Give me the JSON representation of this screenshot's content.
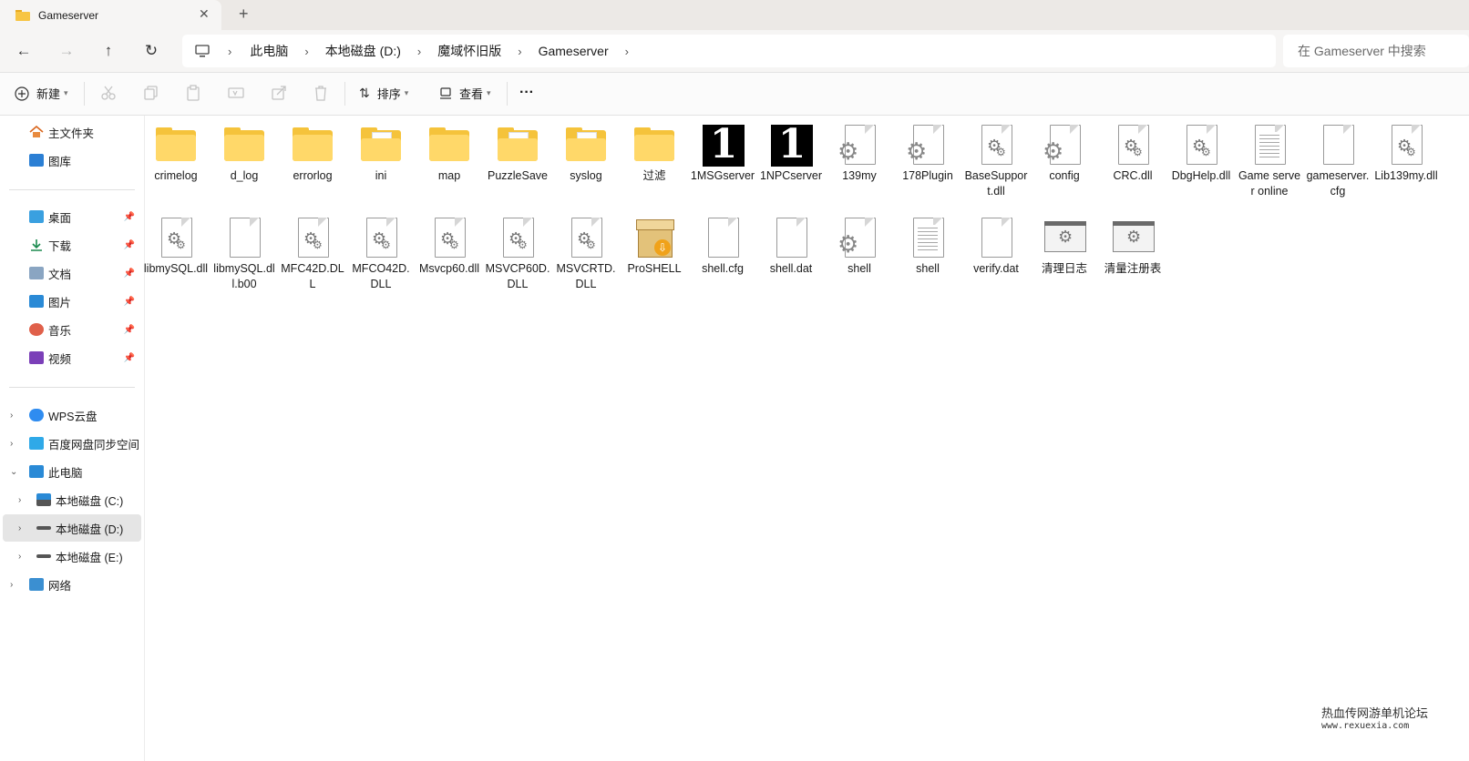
{
  "tab": {
    "title": "Gameserver",
    "close": "✕",
    "new": "+"
  },
  "nav": {
    "back": "←",
    "forward": "→",
    "up": "↑",
    "refresh": "↻"
  },
  "breadcrumb": [
    "此电脑",
    "本地磁盘 (D:)",
    "魔域怀旧版",
    "Gameserver"
  ],
  "breadcrumb_sep": "›",
  "search": {
    "placeholder": "在 Gameserver 中搜索"
  },
  "toolbar": {
    "new_label": "新建",
    "sort_label": "排序",
    "view_label": "查看",
    "more": "···"
  },
  "sidebar": {
    "quick": [
      {
        "label": "主文件夹",
        "icon": "home-icon"
      },
      {
        "label": "图库",
        "icon": "gallery-icon"
      }
    ],
    "pinned": [
      {
        "label": "桌面",
        "icon": "desktop-icon"
      },
      {
        "label": "下载",
        "icon": "download-icon"
      },
      {
        "label": "文档",
        "icon": "documents-icon"
      },
      {
        "label": "图片",
        "icon": "pictures-icon"
      },
      {
        "label": "音乐",
        "icon": "music-icon"
      },
      {
        "label": "视频",
        "icon": "videos-icon"
      }
    ],
    "tree": [
      {
        "label": "WPS云盘",
        "icon": "cloud-icon"
      },
      {
        "label": "百度网盘同步空间",
        "icon": "baidu-icon"
      },
      {
        "label": "此电脑",
        "icon": "computer-icon"
      },
      {
        "label": "本地磁盘 (C:)",
        "icon": "drive-icon"
      },
      {
        "label": "本地磁盘 (D:)",
        "icon": "drive-icon"
      },
      {
        "label": "本地磁盘 (E:)",
        "icon": "drive-icon"
      },
      {
        "label": "网络",
        "icon": "network-icon"
      }
    ]
  },
  "files": [
    {
      "name": "crimelog",
      "type": "folder"
    },
    {
      "name": "d_log",
      "type": "folder"
    },
    {
      "name": "errorlog",
      "type": "folder"
    },
    {
      "name": "ini",
      "type": "folder-doc"
    },
    {
      "name": "map",
      "type": "folder"
    },
    {
      "name": "PuzzleSave",
      "type": "folder-doc"
    },
    {
      "name": "syslog",
      "type": "folder-doc"
    },
    {
      "name": "过滤",
      "type": "folder"
    },
    {
      "name": "1MSGserver",
      "type": "black"
    },
    {
      "name": "1NPCserver",
      "type": "black"
    },
    {
      "name": "139my",
      "type": "cfg"
    },
    {
      "name": "178Plugin",
      "type": "cfg"
    },
    {
      "name": "BaseSupport.dll",
      "type": "dll"
    },
    {
      "name": "config",
      "type": "cfg"
    },
    {
      "name": "CRC.dll",
      "type": "dll"
    },
    {
      "name": "DbgHelp.dll",
      "type": "dll"
    },
    {
      "name": "Game server online",
      "type": "text"
    },
    {
      "name": "gameserver.cfg",
      "type": "blank"
    },
    {
      "name": "Lib139my.dll",
      "type": "dll"
    },
    {
      "name": "libmySQL.dll",
      "type": "dll"
    },
    {
      "name": "libmySQL.dll.b00",
      "type": "blank"
    },
    {
      "name": "MFC42D.DLL",
      "type": "dll"
    },
    {
      "name": "MFCO42D.DLL",
      "type": "dll"
    },
    {
      "name": "Msvcp60.dll",
      "type": "dll"
    },
    {
      "name": "MSVCP60D.DLL",
      "type": "dll"
    },
    {
      "name": "MSVCRTD.DLL",
      "type": "dll"
    },
    {
      "name": "ProSHELL",
      "type": "box"
    },
    {
      "name": "shell.cfg",
      "type": "blank"
    },
    {
      "name": "shell.dat",
      "type": "blank"
    },
    {
      "name": "shell",
      "type": "cfg"
    },
    {
      "name": "shell",
      "type": "text"
    },
    {
      "name": "verify.dat",
      "type": "blank"
    },
    {
      "name": "清理日志",
      "type": "win"
    },
    {
      "name": "清量注册表",
      "type": "win"
    }
  ],
  "watermark": {
    "line1": "热血传网游单机论坛",
    "line2": "www.rexuexia.com"
  }
}
